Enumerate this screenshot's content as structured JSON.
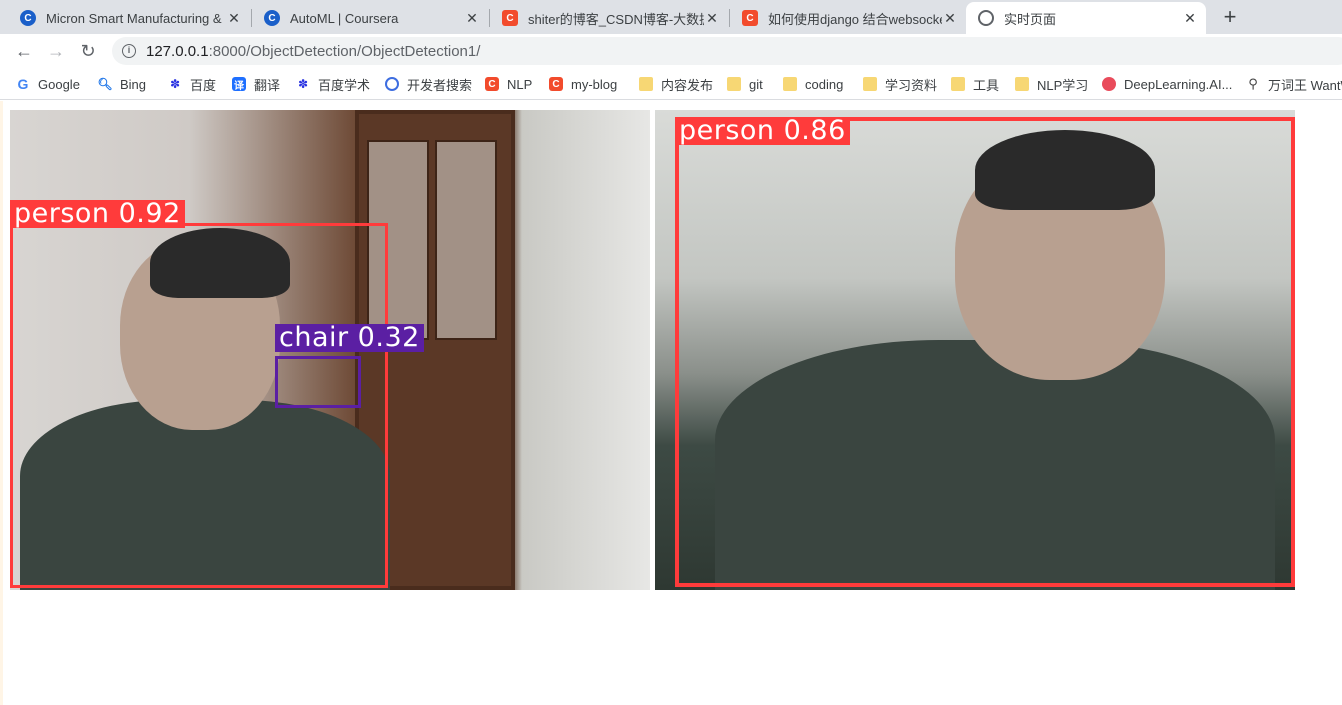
{
  "tabs": [
    {
      "title": "Micron Smart Manufacturing &",
      "icon": "coursera-icon"
    },
    {
      "title": "AutoML | Coursera",
      "icon": "coursera-icon"
    },
    {
      "title": "shiter的博客_CSDN博客-大数据",
      "icon": "csdn-icon"
    },
    {
      "title": "如何使用django 结合websocke",
      "icon": "csdn-icon"
    },
    {
      "title": "实时页面",
      "icon": "globe-icon"
    }
  ],
  "address": {
    "host": "127.0.0.1",
    "port_path": ":8000/ObjectDetection/ObjectDetection1/"
  },
  "bookmarks": [
    {
      "label": "Google"
    },
    {
      "label": "Bing"
    },
    {
      "label": "百度"
    },
    {
      "label": "翻译"
    },
    {
      "label": "百度学术"
    },
    {
      "label": "开发者搜索"
    },
    {
      "label": "NLP"
    },
    {
      "label": "my-blog"
    },
    {
      "label": "内容发布"
    },
    {
      "label": "git"
    },
    {
      "label": "coding"
    },
    {
      "label": "学习资料"
    },
    {
      "label": "工具"
    },
    {
      "label": "NLP学习"
    },
    {
      "label": "DeepLearning.AI..."
    },
    {
      "label": "万词王 WantW"
    }
  ],
  "detections": {
    "frame1": [
      {
        "label": "person 0.92",
        "color": "#ff3b3b"
      },
      {
        "label": "chair 0.32",
        "color": "#5b1fa3"
      }
    ],
    "frame2": [
      {
        "label": "person 0.86",
        "color": "#ff3b3b"
      }
    ]
  },
  "colors": {
    "person_box": "#ff3b3b",
    "chair_box": "#5b1fa3",
    "tabstrip": "#dee1e6"
  }
}
